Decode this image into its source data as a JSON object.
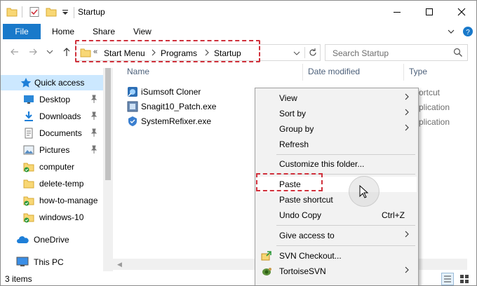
{
  "window": {
    "title": "Startup",
    "controls": [
      "minimize-icon",
      "maximize-icon",
      "close-icon"
    ]
  },
  "ribbon": {
    "tabs": [
      "File",
      "Home",
      "Share",
      "View"
    ]
  },
  "address": {
    "overflow": "«",
    "crumbs": [
      "Start Menu",
      "Programs",
      "Startup"
    ],
    "search_placeholder": "Search Startup"
  },
  "navpane": {
    "items": [
      {
        "label": "Quick access",
        "icon": "star-icon",
        "selected": true
      },
      {
        "label": "Desktop",
        "icon": "desktop-icon",
        "pinned": true
      },
      {
        "label": "Downloads",
        "icon": "download-icon",
        "pinned": true
      },
      {
        "label": "Documents",
        "icon": "documents-icon",
        "pinned": true
      },
      {
        "label": "Pictures",
        "icon": "pictures-icon",
        "pinned": true
      },
      {
        "label": "computer",
        "icon": "synced-folder-icon"
      },
      {
        "label": "delete-temp",
        "icon": "folder-icon"
      },
      {
        "label": "how-to-manage",
        "icon": "synced-folder-icon"
      },
      {
        "label": "windows-10",
        "icon": "synced-folder-icon"
      },
      {
        "label": "OneDrive",
        "icon": "onedrive-icon"
      },
      {
        "label": "This PC",
        "icon": "this-pc-icon"
      }
    ]
  },
  "columns": {
    "name": "Name",
    "date_modified": "Date modified",
    "type": "Type"
  },
  "files": [
    {
      "name": "iSumsoft Cloner",
      "type_partial": "ortcut"
    },
    {
      "name": "Snagit10_Patch.exe",
      "type_partial": "plication"
    },
    {
      "name": "SystemRefixer.exe",
      "type_partial": "plication"
    }
  ],
  "status": {
    "count": "3 items"
  },
  "context_menu": {
    "items": [
      {
        "label": "View",
        "submenu": true
      },
      {
        "label": "Sort by",
        "submenu": true
      },
      {
        "label": "Group by",
        "submenu": true
      },
      {
        "label": "Refresh"
      },
      {
        "label": "Customize this folder..."
      },
      {
        "label": "Paste",
        "hover": true
      },
      {
        "label": "Paste shortcut"
      },
      {
        "label": "Undo Copy",
        "shortcut": "Ctrl+Z"
      },
      {
        "label": "Give access to",
        "submenu": true
      },
      {
        "label": "SVN Checkout...",
        "icon": "svn-checkout-icon"
      },
      {
        "label": "TortoiseSVN",
        "icon": "tortoisesvn-icon",
        "submenu": true
      }
    ]
  },
  "colors": {
    "file_tab": "#1979ca",
    "highlight_dash": "#d0303b",
    "nav_selected": "#cce8ff"
  }
}
